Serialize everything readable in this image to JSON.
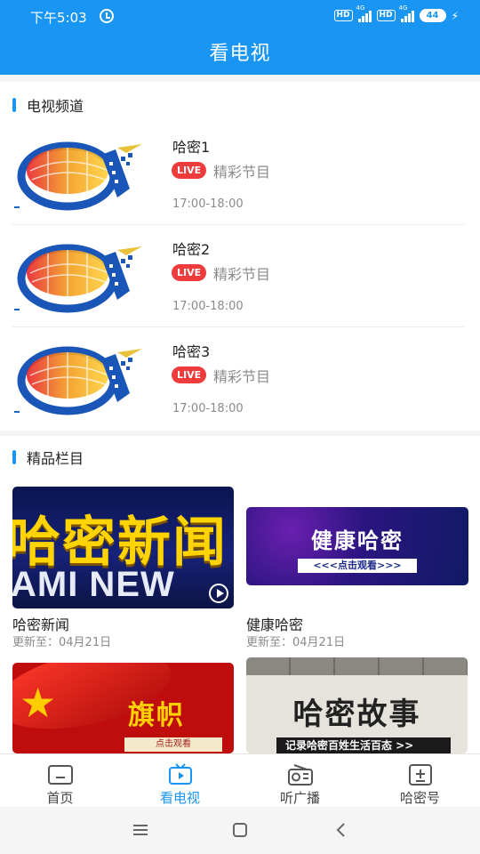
{
  "status": {
    "time": "下午5:03",
    "hd1": "HD",
    "net1": "4G",
    "hd2": "HD",
    "net2": "4G",
    "battery": "44"
  },
  "header": {
    "title": "看电视"
  },
  "tv_section": {
    "title": "电视频道",
    "channels": [
      {
        "name": "哈密1",
        "badge": "LIVE",
        "program": "精彩节目",
        "time": "17:00-18:00"
      },
      {
        "name": "哈密2",
        "badge": "LIVE",
        "program": "精彩节目",
        "time": "17:00-18:00"
      },
      {
        "name": "哈密3",
        "badge": "LIVE",
        "program": "精彩节目",
        "time": "17:00-18:00"
      }
    ]
  },
  "featured_section": {
    "title": "精品栏目",
    "items": [
      {
        "title": "哈密新闻",
        "updated": "更新至：04月21日",
        "thumb_text": "哈密新闻",
        "thumb_sub": "AMI NEW"
      },
      {
        "title": "健康哈密",
        "updated": "更新至：04月21日",
        "thumb_text": "健康哈密",
        "thumb_sub": "<<<点击观看>>>"
      },
      {
        "title": "",
        "updated": "",
        "thumb_text": "旗帜",
        "thumb_sub": "点击观看"
      },
      {
        "title": "",
        "updated": "",
        "thumb_text": "哈密故事",
        "thumb_sub": "记录哈密百姓生活百态  >>"
      }
    ]
  },
  "bottom_nav": {
    "tabs": [
      {
        "label": "首页",
        "icon": "home-icon"
      },
      {
        "label": "看电视",
        "icon": "tv-icon",
        "active": true
      },
      {
        "label": "听广播",
        "icon": "radio-icon"
      },
      {
        "label": "哈密号",
        "icon": "plus-box-icon"
      }
    ]
  },
  "colors": {
    "accent": "#1996f3",
    "live": "#ee3b3b"
  }
}
